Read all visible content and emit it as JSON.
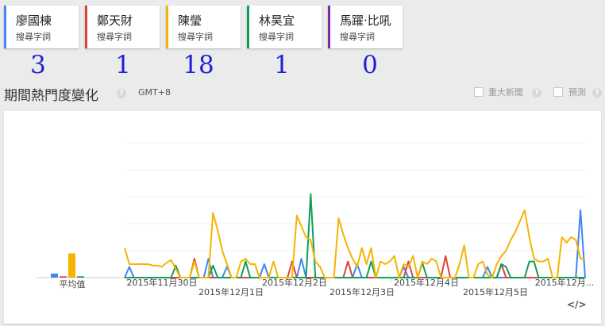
{
  "terms": [
    {
      "name": "廖國棟",
      "sub": "搜尋字詞",
      "color": "#4285f4",
      "count": "3"
    },
    {
      "name": "鄭天財",
      "sub": "搜尋字詞",
      "color": "#db4437",
      "count": "1"
    },
    {
      "name": "陳瑩",
      "sub": "搜尋字詞",
      "color": "#f4b400",
      "count": "18"
    },
    {
      "name": "林昊宜",
      "sub": "搜尋字詞",
      "color": "#0f9d58",
      "count": "1"
    },
    {
      "name": "馬躍·比吼",
      "sub": "搜尋字詞",
      "color": "#7b2f9e",
      "count": "0"
    }
  ],
  "section": {
    "title": "期間熱門度變化",
    "timezone": "GMT+8"
  },
  "options": {
    "news_label": "重大新聞",
    "forecast_label": "預測"
  },
  "icons": {
    "help": "question-circle-icon",
    "embed": "embed-code-icon"
  },
  "embed_glyph": "</>",
  "chart_data": {
    "type": "line",
    "average_label": "平均值",
    "averages": [
      {
        "term": "廖國棟",
        "value": 3
      },
      {
        "term": "鄭天財",
        "value": 1
      },
      {
        "term": "陳瑩",
        "value": 18
      },
      {
        "term": "林昊宜",
        "value": 1
      },
      {
        "term": "馬躍·比吼",
        "value": 0
      }
    ],
    "ylim": [
      0,
      100
    ],
    "grid": true,
    "x_ticks_top": [
      "2015年11月30日",
      "2015年12月2日",
      "2015年12月4日",
      "2015年12月..."
    ],
    "x_ticks_bottom": [
      "2015年12月1日",
      "2015年12月3日",
      "2015年12月5日"
    ],
    "n_points": 100,
    "series": [
      {
        "name": "陳瑩",
        "points": [
          [
            0,
            22
          ],
          [
            1,
            10
          ],
          [
            3,
            10
          ],
          [
            5,
            10
          ],
          [
            6,
            9
          ],
          [
            7,
            9
          ],
          [
            8,
            8
          ],
          [
            9,
            11
          ],
          [
            10,
            13
          ],
          [
            12,
            0
          ],
          [
            13,
            0
          ],
          [
            14,
            0
          ],
          [
            15,
            12
          ],
          [
            16,
            0
          ],
          [
            17,
            0
          ],
          [
            18,
            0
          ],
          [
            19,
            48
          ],
          [
            20,
            35
          ],
          [
            21,
            20
          ],
          [
            22,
            10
          ],
          [
            23,
            0
          ],
          [
            24,
            0
          ],
          [
            25,
            12
          ],
          [
            26,
            14
          ],
          [
            27,
            10
          ],
          [
            28,
            10
          ],
          [
            29,
            0
          ],
          [
            30,
            0
          ],
          [
            31,
            0
          ],
          [
            32,
            12
          ],
          [
            33,
            0
          ],
          [
            34,
            0
          ],
          [
            35,
            0
          ],
          [
            36,
            0
          ],
          [
            37,
            46
          ],
          [
            38,
            38
          ],
          [
            39,
            30
          ],
          [
            40,
            28
          ],
          [
            41,
            12
          ],
          [
            42,
            8
          ],
          [
            43,
            0
          ],
          [
            44,
            0
          ],
          [
            45,
            0
          ],
          [
            46,
            44
          ],
          [
            47,
            32
          ],
          [
            48,
            22
          ],
          [
            49,
            14
          ],
          [
            50,
            8
          ],
          [
            51,
            22
          ],
          [
            52,
            10
          ],
          [
            53,
            22
          ],
          [
            54,
            0
          ],
          [
            55,
            12
          ],
          [
            56,
            10
          ],
          [
            57,
            12
          ],
          [
            58,
            16
          ],
          [
            59,
            0
          ],
          [
            60,
            10
          ],
          [
            61,
            8
          ],
          [
            62,
            16
          ],
          [
            63,
            0
          ],
          [
            64,
            12
          ],
          [
            65,
            10
          ],
          [
            66,
            14
          ],
          [
            67,
            12
          ],
          [
            68,
            0
          ],
          [
            69,
            0
          ],
          [
            70,
            0
          ],
          [
            71,
            0
          ],
          [
            72,
            10
          ],
          [
            73,
            24
          ],
          [
            74,
            0
          ],
          [
            75,
            0
          ],
          [
            76,
            10
          ],
          [
            77,
            12
          ],
          [
            78,
            2
          ],
          [
            79,
            0
          ],
          [
            80,
            10
          ],
          [
            81,
            16
          ],
          [
            82,
            20
          ],
          [
            83,
            28
          ],
          [
            84,
            34
          ],
          [
            85,
            42
          ],
          [
            86,
            50
          ],
          [
            87,
            30
          ],
          [
            88,
            14
          ],
          [
            89,
            12
          ],
          [
            90,
            12
          ],
          [
            91,
            14
          ],
          [
            92,
            0
          ],
          [
            93,
            0
          ],
          [
            94,
            30
          ],
          [
            95,
            26
          ],
          [
            96,
            30
          ],
          [
            97,
            28
          ],
          [
            98,
            14
          ],
          [
            99,
            14
          ]
        ]
      },
      {
        "name": "林昊宜",
        "points": [
          [
            0,
            0
          ],
          [
            10,
            0
          ],
          [
            11,
            9
          ],
          [
            12,
            0
          ],
          [
            18,
            0
          ],
          [
            19,
            9
          ],
          [
            20,
            0
          ],
          [
            25,
            0
          ],
          [
            26,
            12
          ],
          [
            27,
            0
          ],
          [
            39,
            0
          ],
          [
            40,
            62
          ],
          [
            41,
            0
          ],
          [
            52,
            0
          ],
          [
            53,
            12
          ],
          [
            54,
            0
          ],
          [
            63,
            0
          ],
          [
            64,
            11
          ],
          [
            65,
            0
          ],
          [
            80,
            0
          ],
          [
            81,
            10
          ],
          [
            82,
            8
          ],
          [
            83,
            0
          ],
          [
            86,
            0
          ],
          [
            87,
            12
          ],
          [
            88,
            12
          ],
          [
            89,
            0
          ],
          [
            99,
            0
          ]
        ]
      },
      {
        "name": "鄭天財",
        "points": [
          [
            0,
            0
          ],
          [
            14,
            0
          ],
          [
            15,
            14
          ],
          [
            16,
            0
          ],
          [
            35,
            0
          ],
          [
            36,
            12
          ],
          [
            37,
            0
          ],
          [
            47,
            0
          ],
          [
            48,
            12
          ],
          [
            49,
            0
          ],
          [
            60,
            0
          ],
          [
            61,
            12
          ],
          [
            62,
            0
          ],
          [
            68,
            0
          ],
          [
            69,
            16
          ],
          [
            70,
            0
          ],
          [
            80,
            0
          ],
          [
            81,
            10
          ],
          [
            82,
            0
          ],
          [
            99,
            0
          ]
        ]
      },
      {
        "name": "廖國棟",
        "points": [
          [
            0,
            0
          ],
          [
            1,
            8
          ],
          [
            2,
            0
          ],
          [
            17,
            0
          ],
          [
            18,
            14
          ],
          [
            19,
            0
          ],
          [
            21,
            0
          ],
          [
            22,
            8
          ],
          [
            23,
            0
          ],
          [
            29,
            0
          ],
          [
            30,
            10
          ],
          [
            31,
            0
          ],
          [
            37,
            0
          ],
          [
            38,
            14
          ],
          [
            39,
            0
          ],
          [
            49,
            0
          ],
          [
            50,
            10
          ],
          [
            51,
            0
          ],
          [
            59,
            0
          ],
          [
            60,
            8
          ],
          [
            61,
            0
          ],
          [
            77,
            0
          ],
          [
            78,
            8
          ],
          [
            79,
            0
          ],
          [
            97,
            0
          ],
          [
            98,
            50
          ],
          [
            99,
            0
          ]
        ]
      },
      {
        "name": "馬躍·比吼",
        "points": [
          [
            0,
            0
          ],
          [
            99,
            0
          ]
        ]
      }
    ]
  }
}
